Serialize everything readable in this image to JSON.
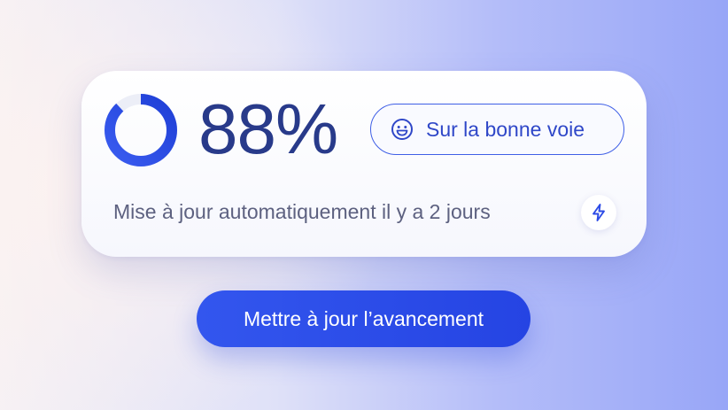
{
  "progress": {
    "value": 0.88,
    "percent_label": "88%",
    "ring_color": "#2c4be6",
    "ring_track_color": "#eceef7"
  },
  "status": {
    "label": "Sur la bonne voie",
    "icon": "smiley-face-icon",
    "color": "#2f47c8"
  },
  "update_info": {
    "text": "Mise à jour automatiquement il y a 2 jours",
    "icon": "lightning-bolt-icon"
  },
  "actions": {
    "update_button_label": "Mettre à jour l’avancement"
  }
}
